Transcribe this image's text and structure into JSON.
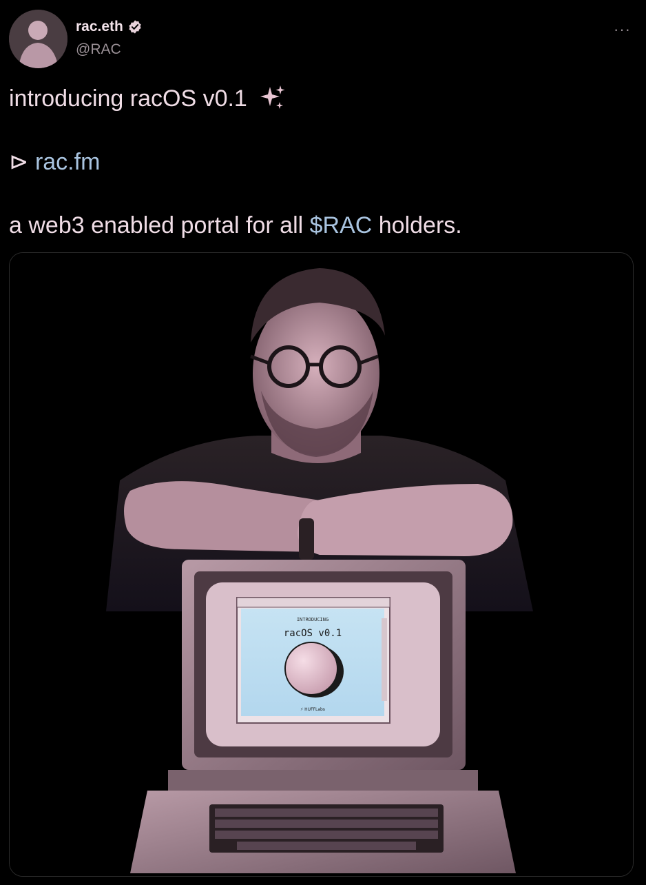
{
  "author": {
    "display_name": "rac.eth",
    "handle": "@RAC",
    "verified": true,
    "avatar_icon": "avatar-photo"
  },
  "menu": {
    "more_label": "···"
  },
  "tweet": {
    "intro_text": "introducing racOS v0.1",
    "sparkle_icon": "sparkles-icon",
    "play_glyph": "⊳",
    "link_text": "rac.fm",
    "line3_before": "a web3 enabled portal for all ",
    "cashtag": "$RAC",
    "line3_after": " holders."
  },
  "media": {
    "screen_kicker": "INTRODUCING",
    "screen_title": "racOS v0.1",
    "screen_footer": "⚡ HUFFLabs",
    "colors": {
      "tint": "#e9c9d6",
      "screen": "#bfe0f2",
      "background": "#000000"
    }
  }
}
